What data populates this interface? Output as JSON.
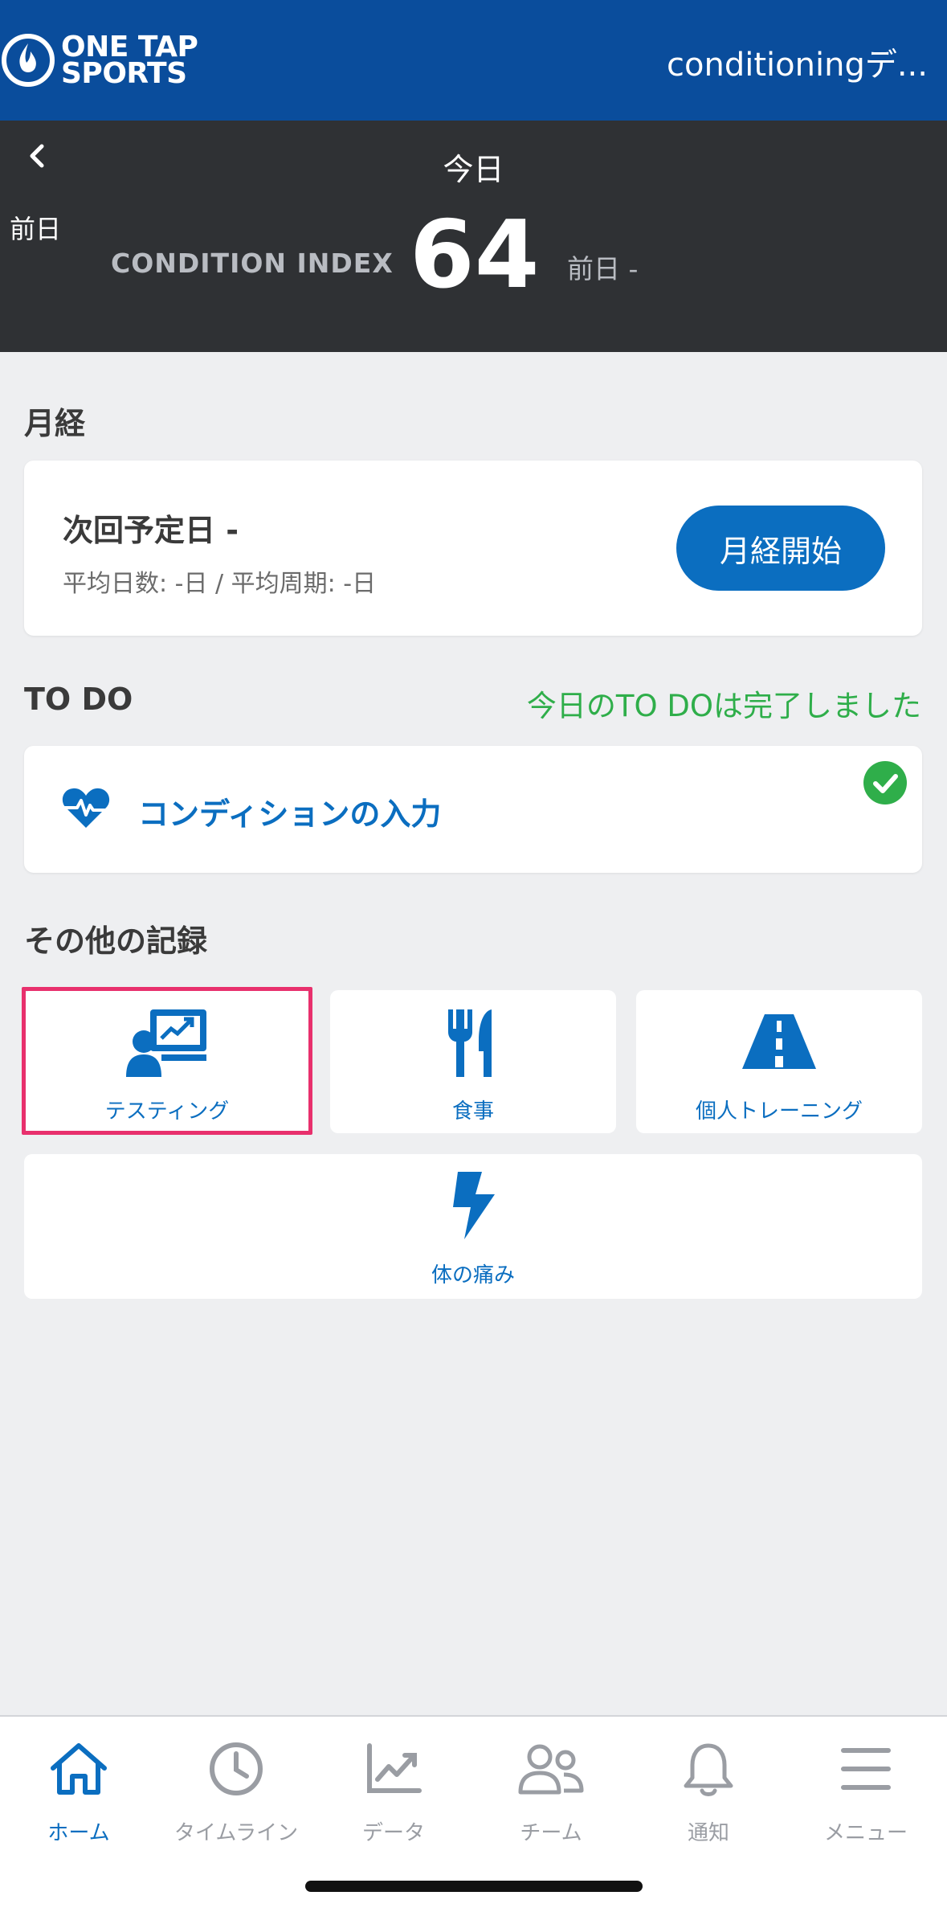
{
  "header": {
    "logo_text_line1": "ONE TAP",
    "logo_text_line2": "SPORTS",
    "app_title": "conditioningデ..."
  },
  "condition": {
    "prev_label": "前日",
    "today_label": "今日",
    "index_label": "CONDITION INDEX",
    "index_value": "64",
    "prev_index": "前日 -"
  },
  "menstruation": {
    "section_title": "月経",
    "next_date": "次回予定日 -",
    "averages": "平均日数: -日  /  平均周期: -日",
    "start_button": "月経開始"
  },
  "todo": {
    "section_title": "TO DO",
    "status": "今日のTO DOは完了しました",
    "item_label": "コンディションの入力",
    "item_done": true
  },
  "other_records": {
    "section_title": "その他の記録",
    "tiles": [
      {
        "label": "テスティング",
        "icon": "presentation-chart-icon",
        "highlighted": true
      },
      {
        "label": "食事",
        "icon": "fork-knife-icon"
      },
      {
        "label": "個人トレーニング",
        "icon": "road-icon"
      },
      {
        "label": "体の痛み",
        "icon": "lightning-bolt-icon"
      }
    ]
  },
  "bottom_nav": {
    "items": [
      {
        "label": "ホーム",
        "icon": "home-icon",
        "active": true
      },
      {
        "label": "タイムライン",
        "icon": "clock-icon"
      },
      {
        "label": "データ",
        "icon": "chart-line-icon"
      },
      {
        "label": "チーム",
        "icon": "team-icon"
      },
      {
        "label": "通知",
        "icon": "bell-icon"
      },
      {
        "label": "メニュー",
        "icon": "hamburger-menu-icon"
      }
    ]
  },
  "colors": {
    "brand_blue": "#0a4d9c",
    "accent_blue": "#0b6ec0",
    "dark_panel": "#2f3134",
    "success_green": "#2fae4a",
    "highlight_pink": "#e8306d"
  }
}
